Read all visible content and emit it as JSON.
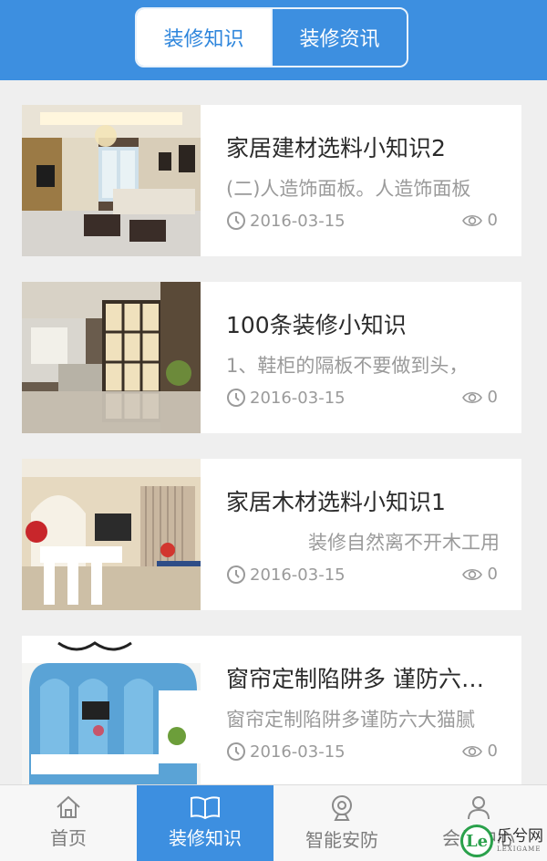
{
  "header": {
    "tabs": [
      {
        "label": "装修知识",
        "active": true
      },
      {
        "label": "装修资讯",
        "active": false
      }
    ]
  },
  "articles": [
    {
      "title": "家居建材选料小知识2",
      "summary": "(二)人造饰面板。人造饰面板",
      "date": "2016-03-15",
      "views": "0",
      "image": "living-room-photo"
    },
    {
      "title": "100条装修小知识",
      "summary": "1、鞋柜的隔板不要做到头，",
      "date": "2016-03-15",
      "views": "0",
      "image": "glass-partition-photo"
    },
    {
      "title": "家居木材选料小知识1",
      "summary": "装修自然离不开木工用",
      "date": "2016-03-15",
      "views": "0",
      "image": "dining-room-photo"
    },
    {
      "title": "窗帘定制陷阱多 谨防六大猫腻",
      "summary": "窗帘定制陷阱多谨防六大猫腻",
      "date": "2016-03-15",
      "views": "0",
      "image": "blue-arch-wall-photo"
    }
  ],
  "tabbar": {
    "items": [
      {
        "label": "首页",
        "icon": "home-icon",
        "active": false
      },
      {
        "label": "装修知识",
        "icon": "book-icon",
        "active": true
      },
      {
        "label": "智能安防",
        "icon": "camera-icon",
        "active": false
      },
      {
        "label": "会员中心",
        "icon": "user-icon",
        "active": false
      }
    ]
  },
  "watermark": {
    "main": "乐兮网",
    "sub": "LEXIGAME"
  },
  "colors": {
    "brand_blue": "#3d8fe0",
    "page_bg": "#efefef"
  }
}
